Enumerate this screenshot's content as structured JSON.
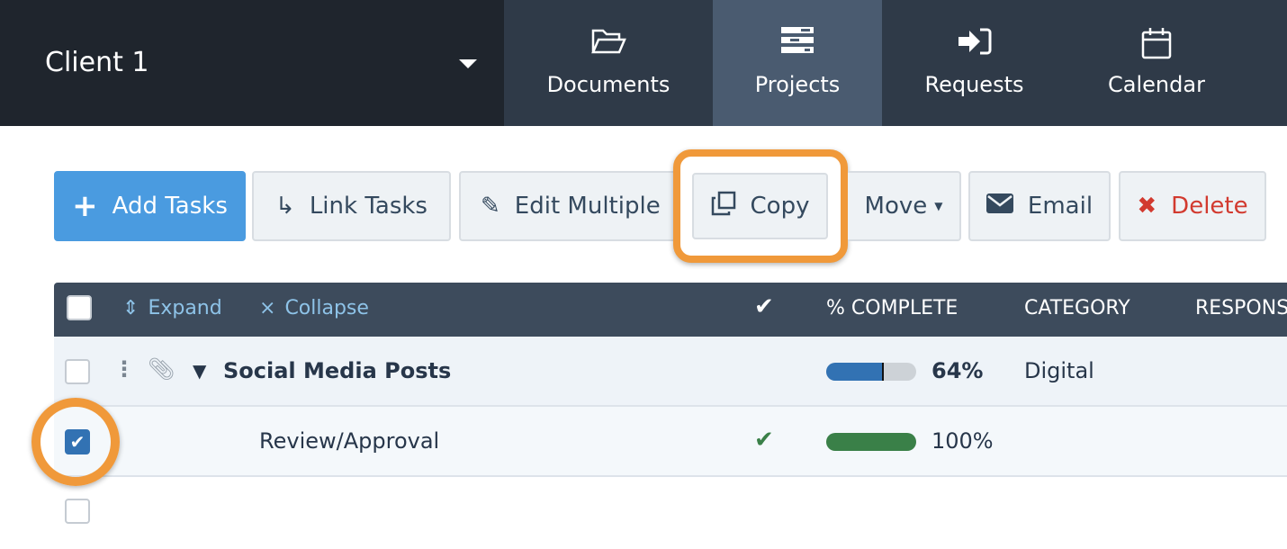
{
  "client": {
    "name": "Client 1"
  },
  "nav": {
    "tabs": [
      {
        "label": "Documents",
        "icon": "folder-open-icon"
      },
      {
        "label": "Projects",
        "icon": "projects-icon",
        "active": true
      },
      {
        "label": "Requests",
        "icon": "sign-in-icon"
      },
      {
        "label": "Calendar",
        "icon": "calendar-icon"
      }
    ]
  },
  "toolbar": {
    "add": "Add Tasks",
    "link": "Link Tasks",
    "edit": "Edit Multiple",
    "copy": "Copy",
    "move": "Move",
    "email": "Email",
    "delete": "Delete"
  },
  "table": {
    "expand": "Expand",
    "collapse": "Collapse",
    "headers": {
      "complete": "% COMPLETE",
      "category": "CATEGORY",
      "responsible": "RESPONS"
    },
    "rows": [
      {
        "name": "Social Media Posts",
        "progress": 64,
        "percent": "64%",
        "category": "Digital",
        "done": false,
        "checked": false
      },
      {
        "name": "Review/Approval",
        "progress": 100,
        "percent": "100%",
        "category": "",
        "done": true,
        "checked": true
      }
    ]
  },
  "colors": {
    "accent": "#4a9be0",
    "highlight": "#f0993a",
    "progress_blue": "#3272b3",
    "progress_green": "#3a8048"
  }
}
